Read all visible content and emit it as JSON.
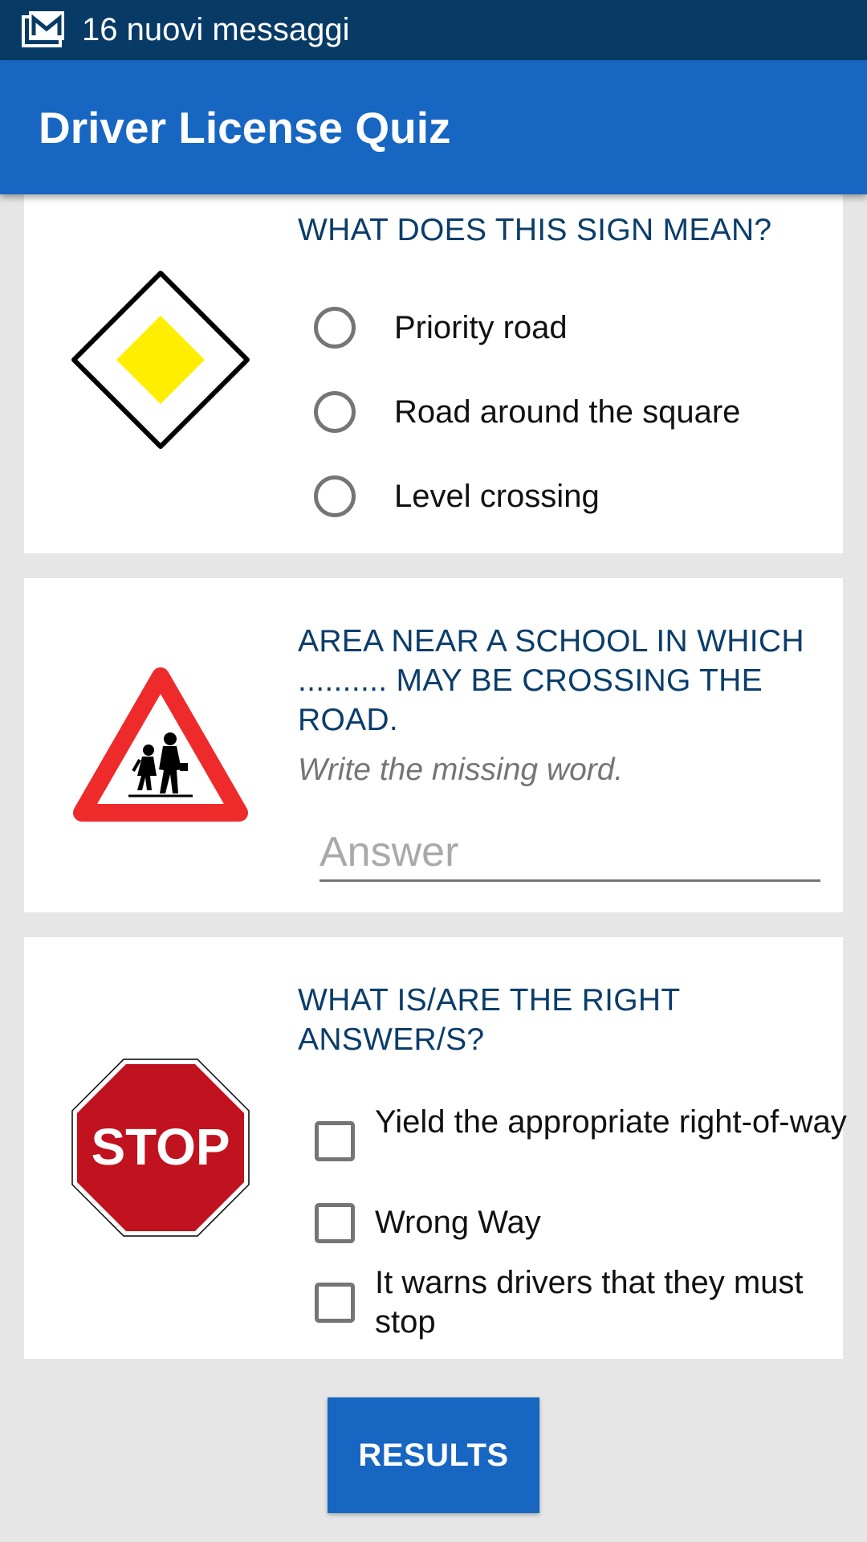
{
  "status_bar": {
    "icon": "mail-notification-icon",
    "text": "16 nuovi messaggi"
  },
  "app_bar": {
    "title": "Driver License Quiz",
    "color": "#1766c2"
  },
  "questions": [
    {
      "sign": "priority-road-sign-icon",
      "prompt": "WHAT DOES THIS SIGN MEAN?",
      "type": "radio",
      "options": [
        "Priority road",
        "Road around the square",
        "Level crossing"
      ]
    },
    {
      "sign": "school-crossing-sign-icon",
      "prompt": "AREA NEAR A SCHOOL IN WHICH .......... MAY BE CROSSING THE ROAD.",
      "hint": "Write the missing word.",
      "type": "text",
      "answer_value": "",
      "answer_placeholder": "Answer"
    },
    {
      "sign": "stop-sign-icon",
      "sign_text": "STOP",
      "prompt": "WHAT IS/ARE THE RIGHT ANSWER/S?",
      "type": "checkbox",
      "options": [
        "Yield the appropriate right-of-way",
        "Wrong Way",
        "It warns drivers that they must stop"
      ]
    }
  ],
  "results_button": {
    "label": "RESULTS"
  },
  "colors": {
    "status_bar": "#083a66",
    "question_text": "#0b3d6a",
    "background": "#e6e6e6"
  }
}
